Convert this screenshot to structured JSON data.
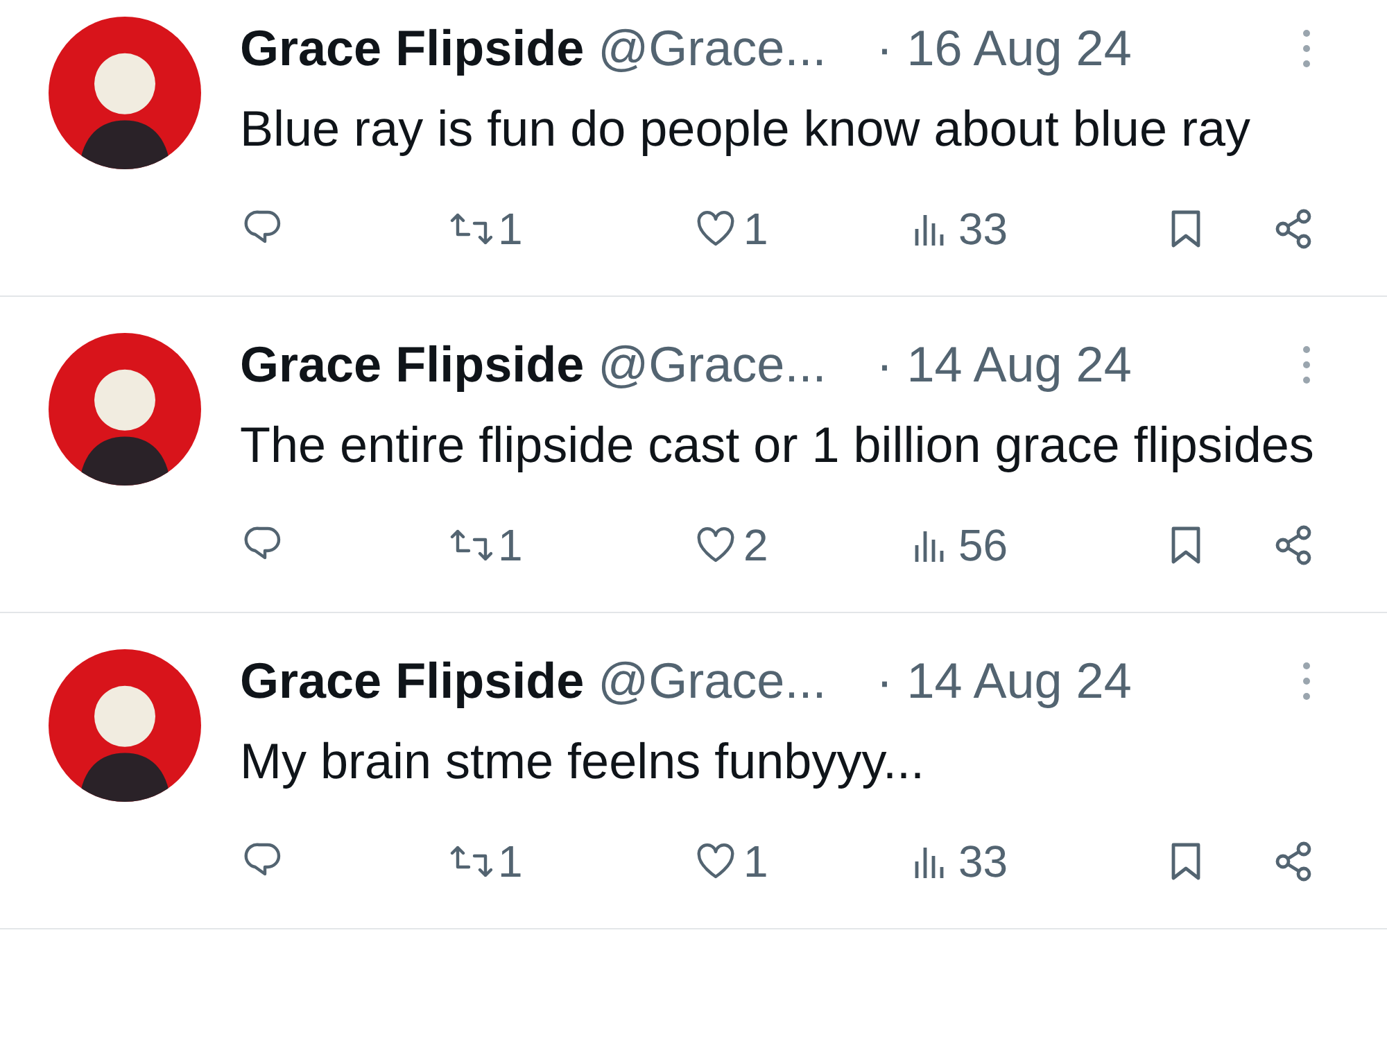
{
  "posts": [
    {
      "author": "Grace Flipside",
      "handle": "@Grace...",
      "date": "· 16 Aug 24",
      "text": "Blue ray is fun do people know about blue ray",
      "retweets": "1",
      "likes": "1",
      "views": "33"
    },
    {
      "author": "Grace Flipside",
      "handle": "@Grace...",
      "date": "· 14 Aug 24",
      "text": "The entire flipside cast or 1 billion grace flipsides",
      "retweets": "1",
      "likes": "2",
      "views": "56"
    },
    {
      "author": "Grace Flipside",
      "handle": "@Grace...",
      "date": "· 14 Aug 24",
      "text": "My brain stme feelns funbyyy...",
      "retweets": "1",
      "likes": "1",
      "views": "33"
    }
  ]
}
